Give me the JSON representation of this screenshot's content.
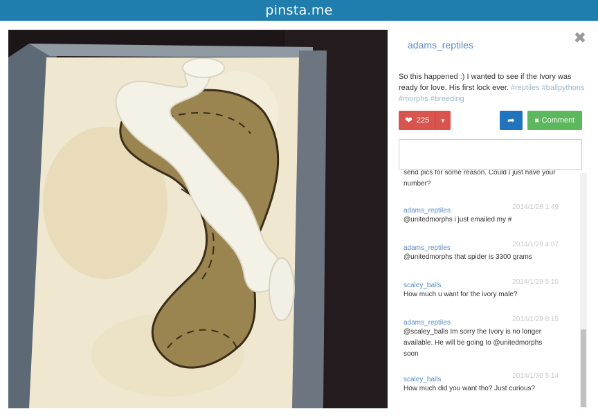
{
  "header": {
    "brand": "pinsta.me"
  },
  "pin": {
    "username": "adams_reptiles",
    "caption": "So this happened :) I wanted to see if the Ivory was ready for love. His first lock ever.",
    "tags": [
      "#reptiles",
      "#ballpythons",
      "#morphs",
      "#breeding"
    ],
    "photo_alt": "ivory-ball-python-and-spider-ball-python"
  },
  "actions": {
    "like_count": "225",
    "comment_label": "Comment"
  },
  "comment_box": {
    "placeholder": ""
  },
  "comments": {
    "partial": "send pics for some reason. Could I just have your number?",
    "items": [
      {
        "author": "adams_reptiles",
        "time": "2014/1/28 1:49",
        "text": "@unitedmorphs i just emailed my #"
      },
      {
        "author": "adams_reptiles",
        "time": "2014/1/28 4:07",
        "text": "@unitedmorphs that spider is 3300 grams"
      },
      {
        "author": "scaley_balls",
        "time": "2014/1/29 5:10",
        "text": "How much u want for the ivory male?"
      },
      {
        "author": "adams_reptiles",
        "time": "2014/1/29 8:15",
        "text": "@scaley_balls Im sorry the Ivory is no longer available. He will be going to @unitedmorphs soon"
      },
      {
        "author": "scaley_balls",
        "time": "2014/1/30 5:14",
        "text": "How much did you want tho? Just curious?"
      }
    ]
  },
  "icons": {
    "close": "close-icon",
    "heart": "heart-icon",
    "share": "share-icon",
    "comment": "comment-icon",
    "caret": "caret-down-icon"
  },
  "colors": {
    "topbar": "#1f7eae",
    "like": "#d9534f",
    "share": "#1f74bd",
    "comment": "#5cb85c",
    "link": "#5b8bbd"
  }
}
